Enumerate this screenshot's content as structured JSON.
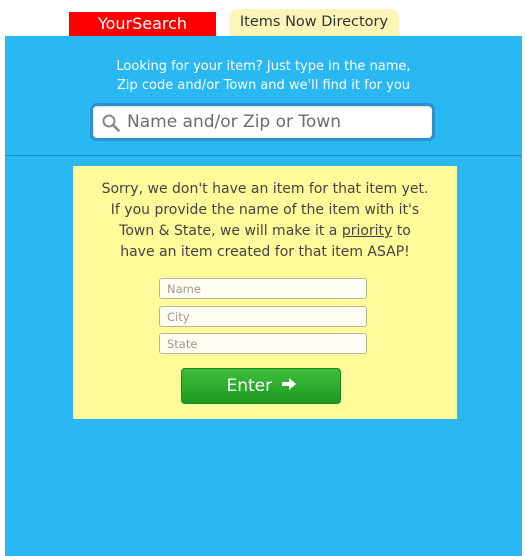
{
  "tabs": {
    "active_label": "YourSearch",
    "directory_label": "Items Now Directory"
  },
  "tagline": {
    "line1": "Looking for your item? Just type in the name,",
    "line2": "Zip code and/or Town and we'll find it for you"
  },
  "search": {
    "placeholder": "Name and/or Zip or Town"
  },
  "notice": {
    "line1": "Sorry, we don't have an item for that item yet.",
    "line2": "If you provide the name of the item with it's",
    "line3_before": "Town & State, we will make it a ",
    "line3_link": "priority",
    "line3_after": " to",
    "line4": "have an item created for that item ASAP!"
  },
  "form": {
    "name_placeholder": "Name",
    "city_placeholder": "City",
    "state_placeholder": "State",
    "submit_label": "Enter"
  },
  "colors": {
    "background": "#2ab8f2",
    "active_tab": "#ff0000",
    "inactive_tab": "#fef6b8",
    "panel": "#fffa9a",
    "button": "#2aad2c"
  },
  "icons": {
    "search": "search-icon",
    "submit_arrow": "arrow-right-icon"
  }
}
